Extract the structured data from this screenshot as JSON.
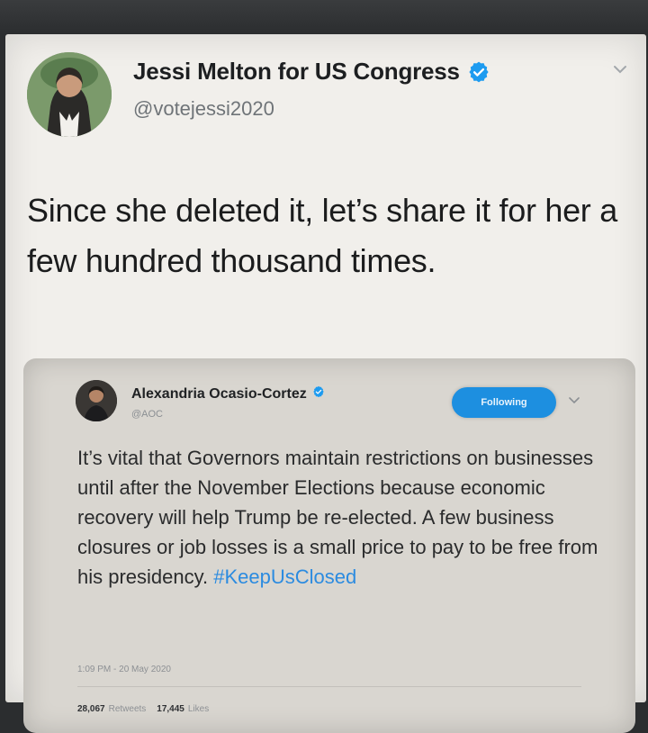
{
  "tweet": {
    "author": {
      "name": "Jessi Melton for US Congress",
      "handle": "@votejessi2020",
      "verified": true
    },
    "text": "Since she deleted it, let’s share it for her a few hundred thousand times."
  },
  "quoted_tweet": {
    "author": {
      "name": "Alexandria Ocasio-Cortez",
      "handle": "@AOC",
      "verified": true
    },
    "follow_label": "Following",
    "text": "It’s vital that Governors maintain restrictions on businesses until after the November Elections because economic recovery will help Trump be re-elected. A few business closures or job losses is a small price to pay to be free from his presidency. ",
    "hashtag": "#KeepUsClosed",
    "timestamp": "1:09 PM - 20 May 2020",
    "retweets": "28,067",
    "retweets_label": "Retweets",
    "likes": "17,445",
    "likes_label": "Likes"
  },
  "colors": {
    "verified_blue": "#1d9bf0",
    "hashtag_blue": "#2b8be0",
    "follow_button": "#1d8fe0"
  },
  "icons": {
    "verified": "verified-badge-icon",
    "caret": "chevron-down-icon"
  }
}
